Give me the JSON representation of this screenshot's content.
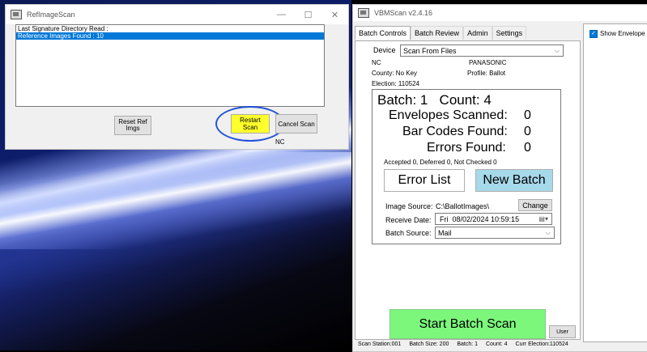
{
  "ref_window": {
    "title": "RefImageScan",
    "controls": {
      "minimize": "—",
      "maximize": "☐",
      "close": "✕"
    },
    "list_items": [
      "Last Signature Directory Read :",
      "Reference Images Found : 10"
    ],
    "selected_index": 1,
    "buttons": {
      "reset_ref": "Reset Ref\nImgs",
      "restart_scan": "Restart Scan",
      "cancel_scan": "Cancel Scan"
    },
    "state_label": "NC",
    "colors": {
      "highlight": "#ffff2c",
      "annotation_circle": "#2254d6"
    }
  },
  "vbm_window": {
    "title": "VBMScan v2.4.16",
    "tabs": [
      "Batch Controls",
      "Batch Review",
      "Admin",
      "Settings"
    ],
    "active_tab": 0,
    "device_label": "Device",
    "device_value": "Scan From Files",
    "state": "NC",
    "scanner": "PANASONIC",
    "county": "County: No Key",
    "profile": "Profile:   Ballot",
    "election": "Election: 110524",
    "batch_line": "Batch: 1   Count: 4",
    "envelopes_label": "Envelopes Scanned:",
    "envelopes_value": "0",
    "barcodes_label": "Bar Codes Found:",
    "barcodes_value": "0",
    "errors_label": "Errors Found:",
    "errors_value": "0",
    "accepted_line": "Accepted 0, Deferred 0, Not Checked 0",
    "error_list_button": "Error List",
    "new_batch_button": "New Batch",
    "image_source_label": "Image Source:",
    "image_source_value": "C:\\BallotImages\\",
    "change_button": "Change",
    "receive_date_label": "Receive Date:",
    "receive_date_value": "Fri  08/02/2024 10:59:15",
    "batch_source_label": "Batch Source:",
    "batch_source_value": "Mail",
    "start_button": "Start Batch Scan",
    "user_button": "User",
    "status": {
      "station": "Scan Station:001",
      "batch_size": "Batch Size: 200",
      "batch": "Batch: 1",
      "count": "Count: 4",
      "election": "Curr Election:110524"
    },
    "show_envelope_label": "Show Envelope Ima",
    "colors": {
      "start": "#7cf77c",
      "new_batch": "#a6d9ea"
    }
  }
}
